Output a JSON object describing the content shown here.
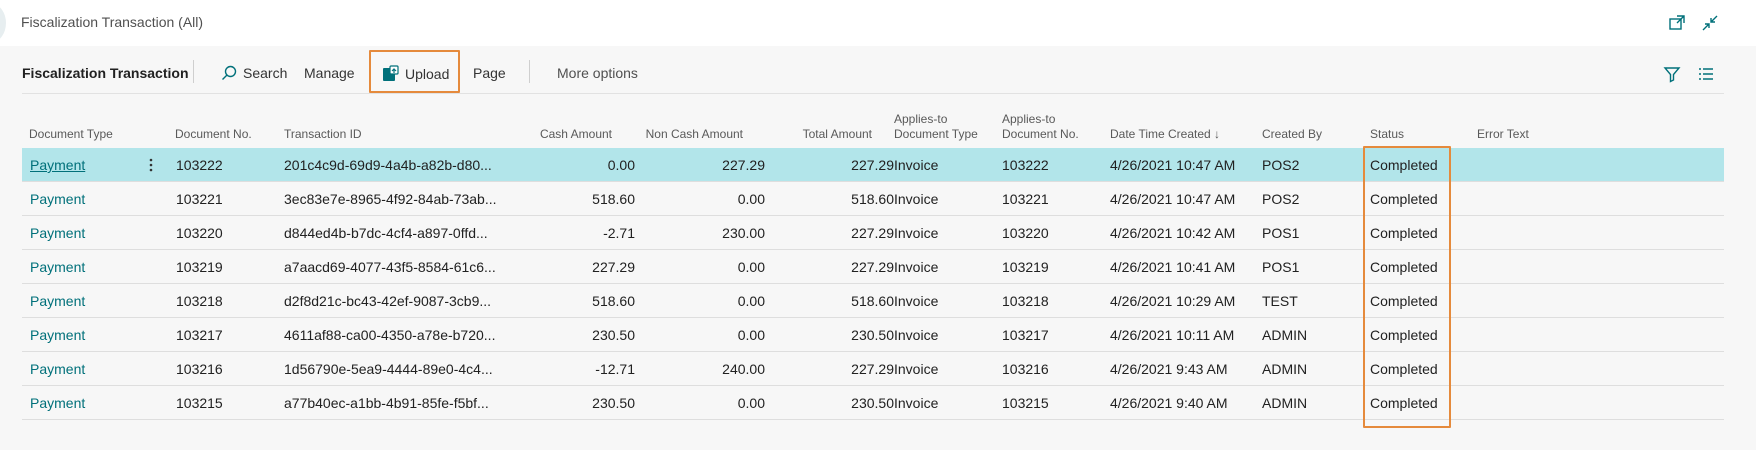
{
  "header": {
    "page_title": "Fiscalization Transaction (All)",
    "icons": [
      "open-in-new-window-icon",
      "collapse-icon"
    ]
  },
  "actionbar": {
    "title": "Fiscalization Transaction",
    "search_label": "Search",
    "manage_label": "Manage",
    "upload_label": "Upload",
    "page_label": "Page",
    "more_options_label": "More options",
    "right_icons": [
      "filter-icon",
      "list-view-icon"
    ]
  },
  "table": {
    "columns": {
      "document_type": "Document Type",
      "document_no": "Document No.",
      "transaction_id": "Transaction ID",
      "cash_amount": "Cash Amount",
      "non_cash_amount": "Non Cash Amount",
      "total_amount": "Total Amount",
      "applies_to_doc_type_1": "Applies-to",
      "applies_to_doc_type_2": "Document Type",
      "applies_to_doc_no_1": "Applies-to",
      "applies_to_doc_no_2": "Document No.",
      "date_time_created": "Date Time Created ↓",
      "created_by": "Created By",
      "status": "Status",
      "error_text": "Error Text"
    },
    "rows": [
      {
        "document_type": "Payment",
        "document_no": "103222",
        "transaction_id": "201c4c9d-69d9-4a4b-a82b-d80...",
        "cash_amount": "0.00",
        "non_cash_amount": "227.29",
        "total_amount": "227.29",
        "applies_to_doc_type": "Invoice",
        "applies_to_doc_no": "103222",
        "date_time_created": "4/26/2021 10:47 AM",
        "created_by": "POS2",
        "status": "Completed",
        "error_text": ""
      },
      {
        "document_type": "Payment",
        "document_no": "103221",
        "transaction_id": "3ec83e7e-8965-4f92-84ab-73ab...",
        "cash_amount": "518.60",
        "non_cash_amount": "0.00",
        "total_amount": "518.60",
        "applies_to_doc_type": "Invoice",
        "applies_to_doc_no": "103221",
        "date_time_created": "4/26/2021 10:47 AM",
        "created_by": "POS2",
        "status": "Completed",
        "error_text": ""
      },
      {
        "document_type": "Payment",
        "document_no": "103220",
        "transaction_id": "d844ed4b-b7dc-4cf4-a897-0ffd...",
        "cash_amount": "-2.71",
        "non_cash_amount": "230.00",
        "total_amount": "227.29",
        "applies_to_doc_type": "Invoice",
        "applies_to_doc_no": "103220",
        "date_time_created": "4/26/2021 10:42 AM",
        "created_by": "POS1",
        "status": "Completed",
        "error_text": ""
      },
      {
        "document_type": "Payment",
        "document_no": "103219",
        "transaction_id": "a7aacd69-4077-43f5-8584-61c6...",
        "cash_amount": "227.29",
        "non_cash_amount": "0.00",
        "total_amount": "227.29",
        "applies_to_doc_type": "Invoice",
        "applies_to_doc_no": "103219",
        "date_time_created": "4/26/2021 10:41 AM",
        "created_by": "POS1",
        "status": "Completed",
        "error_text": ""
      },
      {
        "document_type": "Payment",
        "document_no": "103218",
        "transaction_id": "d2f8d21c-bc43-42ef-9087-3cb9...",
        "cash_amount": "518.60",
        "non_cash_amount": "0.00",
        "total_amount": "518.60",
        "applies_to_doc_type": "Invoice",
        "applies_to_doc_no": "103218",
        "date_time_created": "4/26/2021 10:29 AM",
        "created_by": "TEST",
        "status": "Completed",
        "error_text": ""
      },
      {
        "document_type": "Payment",
        "document_no": "103217",
        "transaction_id": "4611af88-ca00-4350-a78e-b720...",
        "cash_amount": "230.50",
        "non_cash_amount": "0.00",
        "total_amount": "230.50",
        "applies_to_doc_type": "Invoice",
        "applies_to_doc_no": "103217",
        "date_time_created": "4/26/2021 10:11 AM",
        "created_by": "ADMIN",
        "status": "Completed",
        "error_text": ""
      },
      {
        "document_type": "Payment",
        "document_no": "103216",
        "transaction_id": "1d56790e-5ea9-4444-89e0-4c4...",
        "cash_amount": "-12.71",
        "non_cash_amount": "240.00",
        "total_amount": "227.29",
        "applies_to_doc_type": "Invoice",
        "applies_to_doc_no": "103216",
        "date_time_created": "4/26/2021 9:43 AM",
        "created_by": "ADMIN",
        "status": "Completed",
        "error_text": ""
      },
      {
        "document_type": "Payment",
        "document_no": "103215",
        "transaction_id": "a77b40ec-a1bb-4b91-85fe-f5bf...",
        "cash_amount": "230.50",
        "non_cash_amount": "0.00",
        "total_amount": "230.50",
        "applies_to_doc_type": "Invoice",
        "applies_to_doc_no": "103215",
        "date_time_created": "4/26/2021 9:40 AM",
        "created_by": "ADMIN",
        "status": "Completed",
        "error_text": ""
      }
    ]
  },
  "colors": {
    "accent": "#00707a",
    "selected_row": "#b2e5ea",
    "highlight": "#e58a3c"
  }
}
